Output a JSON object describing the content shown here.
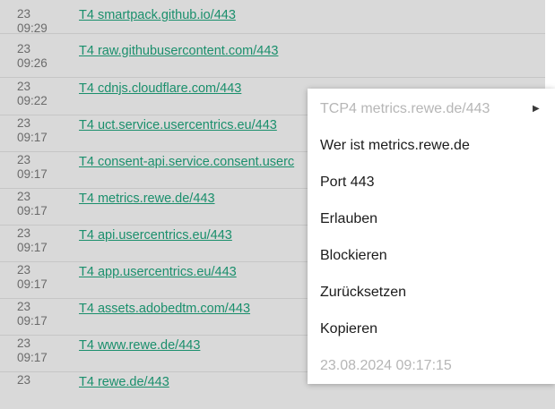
{
  "rows": [
    {
      "day": "23",
      "time": "09:29",
      "link": "T4 smartpack.github.io/443"
    },
    {
      "day": "23",
      "time": "09:26",
      "link": "T4 raw.githubusercontent.com/443"
    },
    {
      "day": "23",
      "time": "09:22",
      "link": "T4 cdnjs.cloudflare.com/443"
    },
    {
      "day": "23",
      "time": "09:17",
      "link": "T4 uct.service.usercentrics.eu/443"
    },
    {
      "day": "23",
      "time": "09:17",
      "link": "T4 consent-api.service.consent.userc"
    },
    {
      "day": "23",
      "time": "09:17",
      "link": "T4 metrics.rewe.de/443"
    },
    {
      "day": "23",
      "time": "09:17",
      "link": "T4 api.usercentrics.eu/443"
    },
    {
      "day": "23",
      "time": "09:17",
      "link": "T4 app.usercentrics.eu/443"
    },
    {
      "day": "23",
      "time": "09:17",
      "link": "T4 assets.adobedtm.com/443"
    },
    {
      "day": "23",
      "time": "09:17",
      "link": "T4 www.rewe.de/443"
    },
    {
      "day": "23",
      "time": "",
      "link": "T4 rewe.de/443"
    }
  ],
  "menu": {
    "header": "TCP4 metrics.rewe.de/443",
    "header_arrow_icon": "triangle-right-icon",
    "items": [
      "Wer ist metrics.rewe.de",
      "Port 443",
      "Erlauben",
      "Blockieren",
      "Zurücksetzen",
      "Kopieren"
    ],
    "timestamp": "23.08.2024 09:17:15"
  },
  "colors": {
    "link": "#1a8f6c",
    "background": "#d9d9d9",
    "menu": "#ffffff"
  }
}
